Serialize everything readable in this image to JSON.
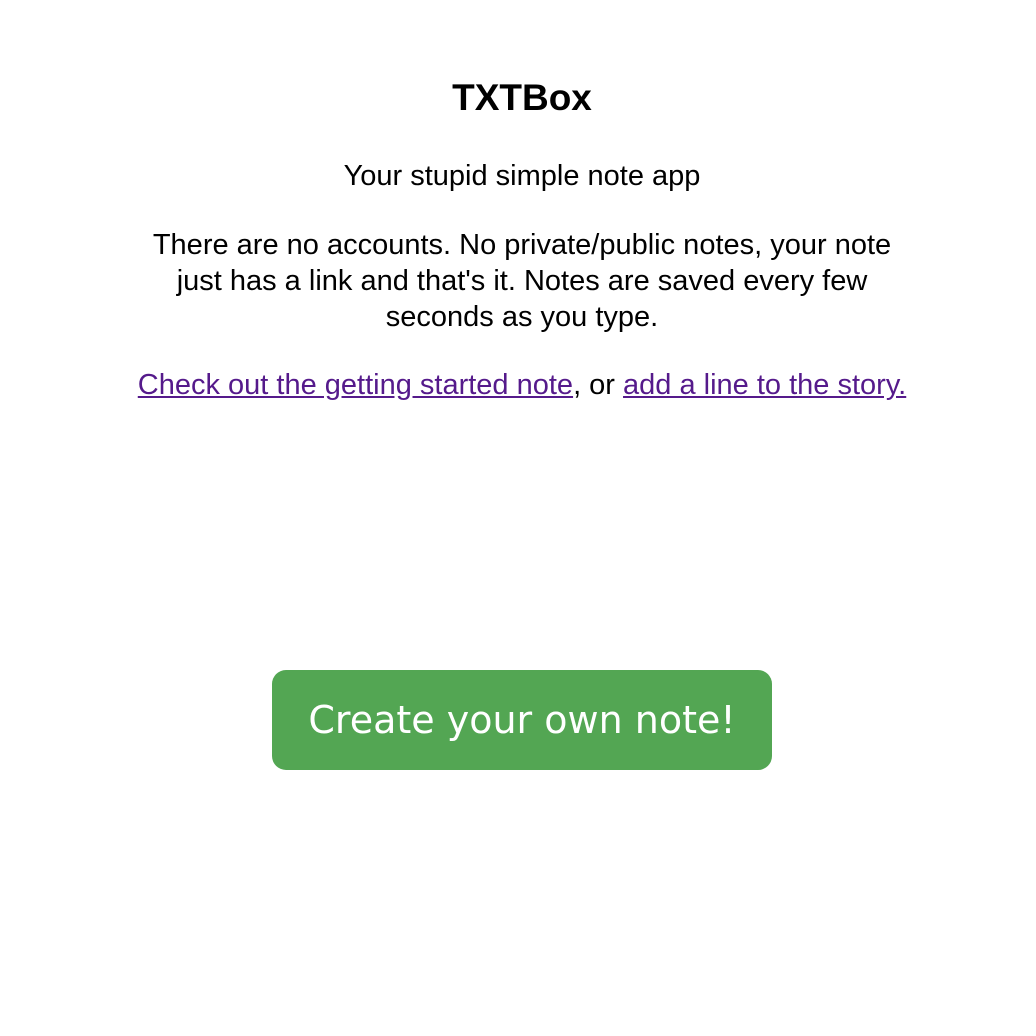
{
  "header": {
    "title": "TXTBox",
    "subtitle": "Your stupid simple note app"
  },
  "description": "There are no accounts. No private/public notes, your note just has a link and that's it. Notes are saved every few seconds as you type.",
  "links": {
    "getting_started_label": "Check out the getting started note",
    "separator": ", or ",
    "story_label": "add a line to the story."
  },
  "create_button": {
    "label": "Create your own note!"
  },
  "colors": {
    "link": "#551a8b",
    "button_background": "#53a653",
    "button_text": "#ffffff",
    "page_background": "#ffffff"
  }
}
